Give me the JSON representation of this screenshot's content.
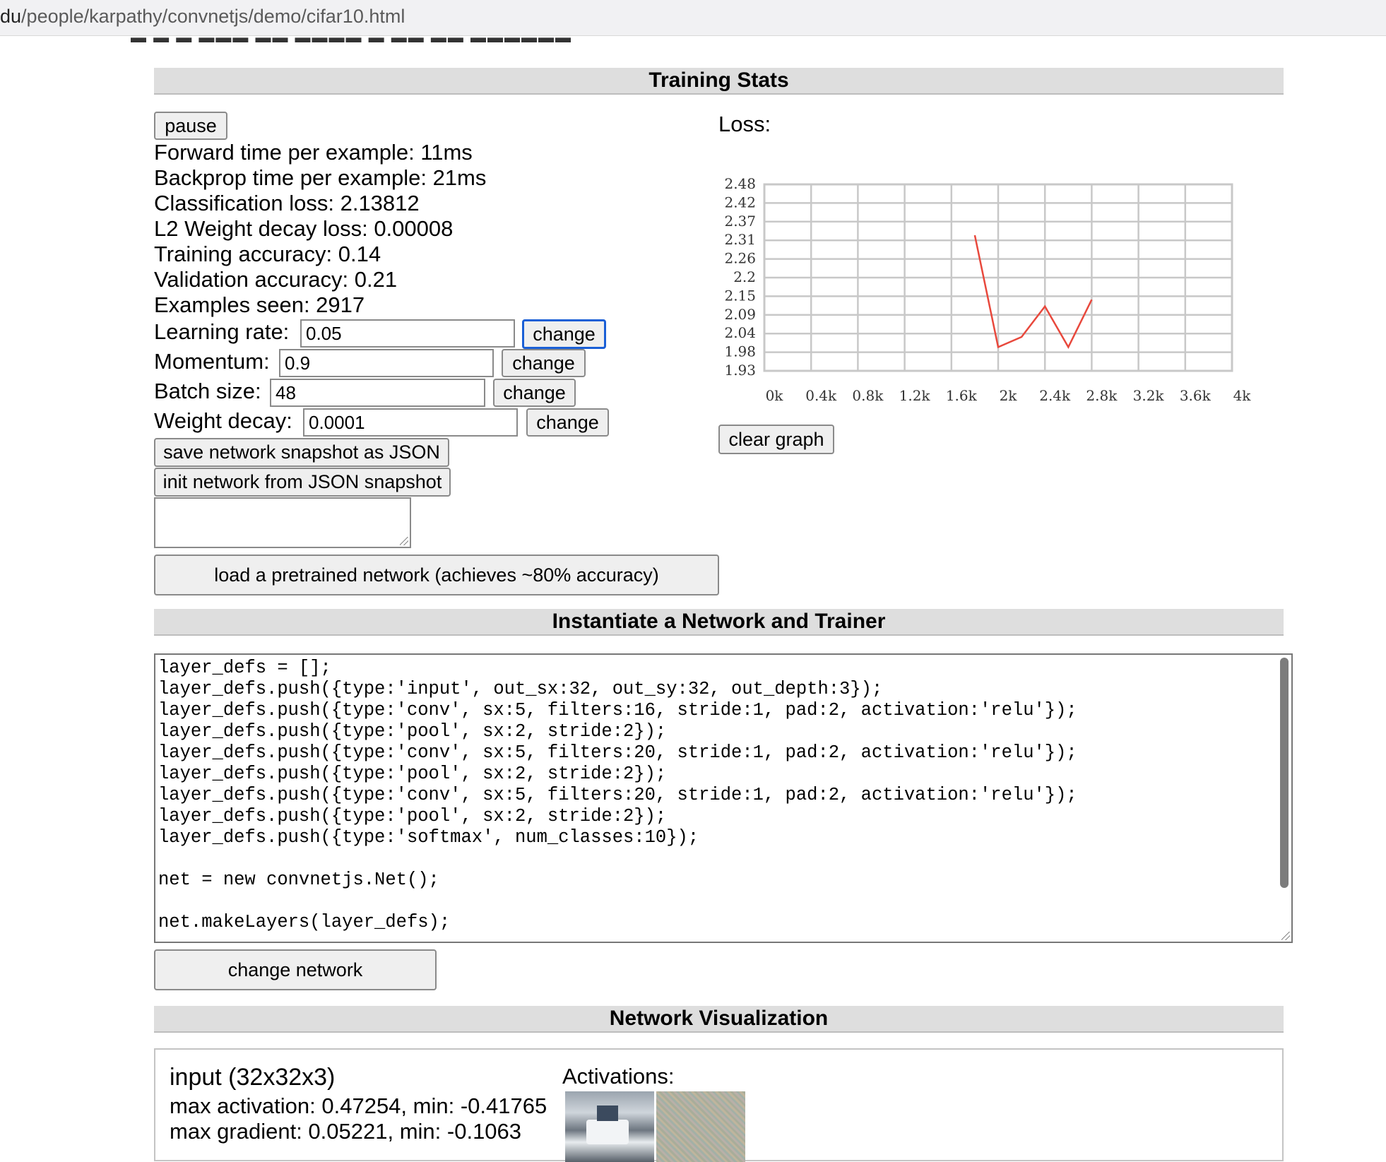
{
  "browser": {
    "url_prefix": "du",
    "url_rest": "/people/karpathy/convnetjs/demo/cifar10.html"
  },
  "sections": {
    "training_stats": "Training Stats",
    "instantiate": "Instantiate a Network and Trainer",
    "visualization": "Network Visualization"
  },
  "controls": {
    "pause_label": "pause",
    "change_label": "change",
    "save_snapshot_label": "save network snapshot as JSON",
    "init_snapshot_label": "init network from JSON snapshot",
    "load_pretrained_label": "load a pretrained network (achieves ~80% accuracy)",
    "change_network_label": "change network",
    "clear_graph_label": "clear graph"
  },
  "stats": {
    "forward_time": "Forward time per example: 11ms",
    "backprop_time": "Backprop time per example: 21ms",
    "classification_loss": "Classification loss: 2.13812",
    "l2_loss": "L2 Weight decay loss: 0.00008",
    "training_accuracy": "Training accuracy: 0.14",
    "validation_accuracy": "Validation accuracy: 0.21",
    "examples_seen": "Examples seen: 2917"
  },
  "params": {
    "learning_rate_label": "Learning rate:",
    "learning_rate_value": "0.05",
    "momentum_label": "Momentum:",
    "momentum_value": "0.9",
    "batch_size_label": "Batch size:",
    "batch_size_value": "48",
    "weight_decay_label": "Weight decay:",
    "weight_decay_value": "0.0001"
  },
  "loss_chart_label": "Loss:",
  "chart_data": {
    "type": "line",
    "title": "Loss:",
    "y_ticks": [
      "2.48",
      "2.42",
      "2.37",
      "2.31",
      "2.26",
      "2.2",
      "2.15",
      "2.09",
      "2.04",
      "1.98",
      "1.93"
    ],
    "x_ticks": [
      "0k",
      "0.4k",
      "0.8k",
      "1.2k",
      "1.6k",
      "2k",
      "2.4k",
      "2.8k",
      "3.2k",
      "3.6k",
      "4k"
    ],
    "xlim": [
      0,
      4000
    ],
    "ylim": [
      1.93,
      2.48
    ],
    "grid": true,
    "series": [
      {
        "color": "#e8483c",
        "x": [
          1800,
          2000,
          2200,
          2400,
          2600,
          2800
        ],
        "y": [
          2.33,
          2.0,
          2.03,
          2.12,
          2.0,
          2.14
        ]
      }
    ]
  },
  "code": {
    "lines": [
      "layer_defs = [];",
      "layer_defs.push({type:'input', out_sx:32, out_sy:32, out_depth:3});",
      "layer_defs.push({type:'conv', sx:5, filters:16, stride:1, pad:2, activation:'relu'});",
      "layer_defs.push({type:'pool', sx:2, stride:2});",
      "layer_defs.push({type:'conv', sx:5, filters:20, stride:1, pad:2, activation:'relu'});",
      "layer_defs.push({type:'pool', sx:2, stride:2});",
      "layer_defs.push({type:'conv', sx:5, filters:20, stride:1, pad:2, activation:'relu'});",
      "layer_defs.push({type:'pool', sx:2, stride:2});",
      "layer_defs.push({type:'softmax', num_classes:10});",
      "",
      "net = new convnetjs.Net();",
      "",
      "net.makeLayers(layer_defs);"
    ]
  },
  "visualization": {
    "layer_title": "input (32x32x3)",
    "activation_stats": "max activation: 0.47254, min: -0.41765",
    "gradient_stats": "max gradient: 0.05221, min: -0.1063",
    "activations_label": "Activations:"
  }
}
